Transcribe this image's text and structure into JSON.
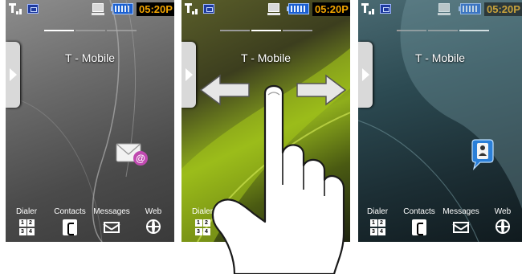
{
  "screens": [
    {
      "status": {
        "time": "05:20P"
      },
      "carrier": "T - Mobile",
      "dock": {
        "items": [
          {
            "label": "Dialer",
            "icon": "dialer-keypad-icon",
            "keys": [
              "1",
              "2",
              "3",
              "4"
            ]
          },
          {
            "label": "Contacts",
            "icon": "contacts-phone-icon"
          },
          {
            "label": "Messages",
            "icon": "messages-envelope-icon"
          },
          {
            "label": "Web",
            "icon": "web-globe-icon"
          }
        ]
      },
      "widget_icon": "email-at-icon",
      "pager_active": 0
    },
    {
      "status": {
        "time": "05:20P"
      },
      "carrier": "T - Mobile",
      "dock": {
        "items": [
          {
            "label": "Dialer",
            "icon": "dialer-keypad-icon",
            "keys": [
              "1",
              "2",
              "3",
              "4"
            ]
          }
        ]
      },
      "gesture": "swipe-left-right-hand-icon",
      "pager_active": 1
    },
    {
      "status": {
        "time": "05:20P"
      },
      "carrier": "T - Mobile",
      "dock": {
        "items": [
          {
            "label": "Dialer",
            "icon": "dialer-keypad-icon",
            "keys": [
              "1",
              "2",
              "3",
              "4"
            ]
          },
          {
            "label": "Contacts",
            "icon": "contacts-phone-icon"
          },
          {
            "label": "Messages",
            "icon": "messages-envelope-icon"
          },
          {
            "label": "Web",
            "icon": "web-globe-icon"
          }
        ]
      },
      "widget_icon": "contact-card-icon",
      "pager_active": 2
    }
  ],
  "colors": {
    "time_fg": "#f2a400",
    "accent_green": "#8fae1c",
    "battery": "#1a5fd0"
  }
}
